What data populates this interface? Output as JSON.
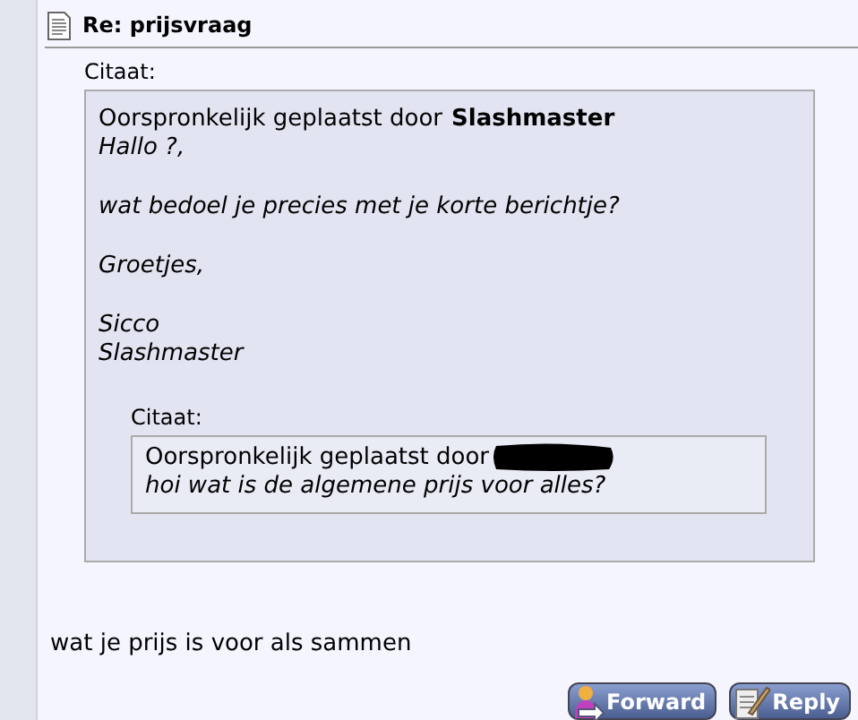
{
  "post": {
    "title": "Re: prijsvraag",
    "quote": {
      "label": "Citaat:",
      "byline": "Oorspronkelijk geplaatst door",
      "author": "Slashmaster",
      "paragraphs": [
        [
          "Hallo ?,"
        ],
        [
          "wat bedoel je precies met je korte berichtje?"
        ],
        [
          "Groetjes,"
        ],
        [
          "Sicco",
          "Slashmaster"
        ]
      ],
      "nested_quote": {
        "label": "Citaat:",
        "byline": "Oorspronkelijk geplaatst door",
        "author_redacted": true,
        "lines": [
          "hoi wat is de algemene prijs voor alles?"
        ]
      }
    },
    "message": "wat je prijs is voor als sammen",
    "buttons": [
      {
        "kind": "forward",
        "label": "Forward"
      },
      {
        "kind": "reply",
        "label": "Reply"
      }
    ]
  }
}
